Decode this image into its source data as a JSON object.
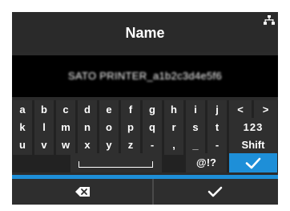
{
  "screen": {
    "title": "Name",
    "name_value": "SATO PRINTER_a1b2c3d4e5f6"
  },
  "keyboard": {
    "rows": [
      [
        "a",
        "b",
        "c",
        "d",
        "e",
        "f",
        "g",
        "h",
        "i",
        "j",
        "<",
        ">"
      ],
      [
        "k",
        "l",
        "m",
        "n",
        "o",
        "p",
        "q",
        "r",
        "s",
        "t",
        "123"
      ],
      [
        "u",
        "v",
        "w",
        "x",
        "y",
        "z",
        "-",
        ",",
        "_",
        "-",
        "Shift"
      ],
      [
        "@!?"
      ]
    ],
    "selected_key": "enter"
  },
  "bottom": {
    "backspace_icon": "backspace-icon",
    "confirm_icon": "check-icon"
  },
  "colors": {
    "accent": "#1e8fd8",
    "panel": "#2b2b2b",
    "field": "#000000"
  }
}
